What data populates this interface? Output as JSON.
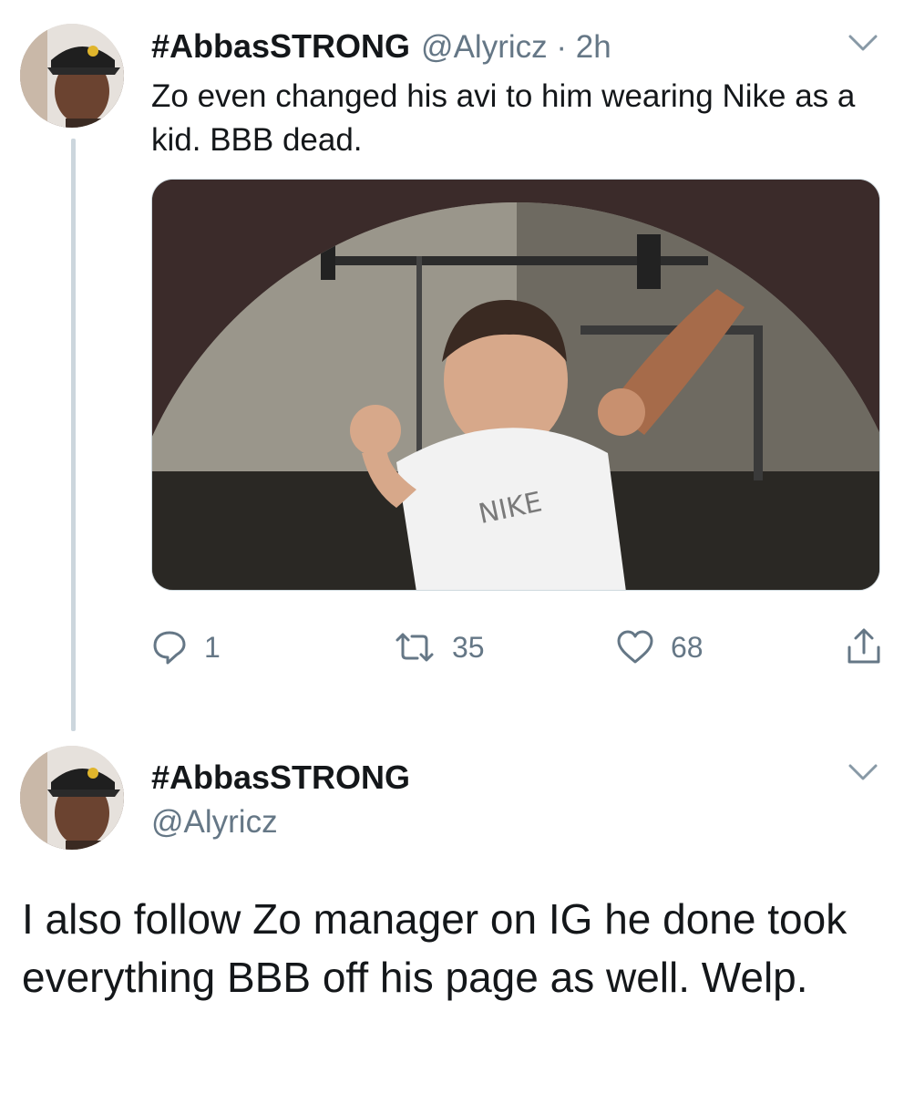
{
  "tweet1": {
    "display_name": "#AbbasSTRONG",
    "handle_time": "@Alyricz · 2h",
    "text": "Zo even changed his avi to him wearing Nike as a kid. BBB dead.",
    "media": {
      "shirt_text": "NIKE"
    },
    "actions": {
      "reply_count": "1",
      "retweet_count": "35",
      "like_count": "68"
    }
  },
  "tweet2": {
    "display_name": "#AbbasSTRONG",
    "handle": "@Alyricz",
    "text": "I also follow Zo manager on IG he done took everything BBB off his page as well. Welp."
  },
  "colors": {
    "text": "#14171a",
    "secondary": "#657786",
    "thread_line": "#ccd6dd",
    "media_bg": "#3b2b2a"
  },
  "icons": [
    "avatar-photo",
    "chevron-down-icon",
    "reply-icon",
    "retweet-icon",
    "like-icon",
    "share-icon"
  ]
}
